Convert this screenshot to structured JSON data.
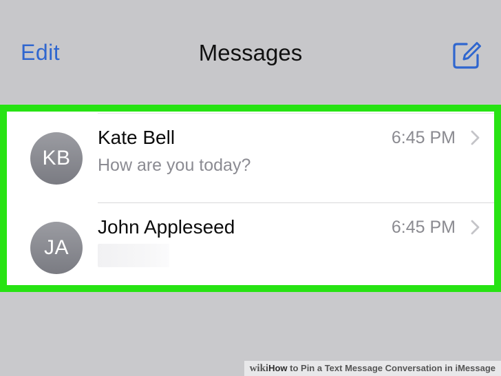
{
  "header": {
    "edit_label": "Edit",
    "title": "Messages",
    "compose_icon": "compose-icon"
  },
  "conversations": [
    {
      "initials": "KB",
      "name": "Kate Bell",
      "time": "6:45 PM",
      "preview": "How are you today?"
    },
    {
      "initials": "JA",
      "name": "John Appleseed",
      "time": "6:45 PM",
      "preview": ""
    }
  ],
  "colors": {
    "accent": "#2f66cf",
    "highlight_border": "#27e313",
    "background": "#c9c9cc"
  },
  "footer": {
    "site": "wiki",
    "how": "How",
    "rest": " to Pin a Text Message Conversation in iMessage"
  }
}
